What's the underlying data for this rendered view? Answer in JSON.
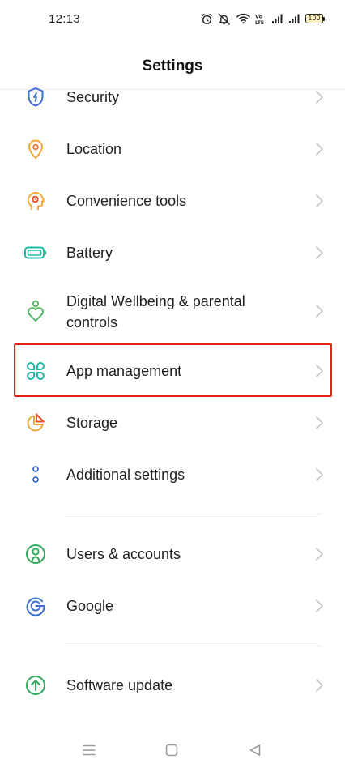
{
  "status_bar": {
    "time": "12:13",
    "battery_level": "100",
    "icons": [
      "alarm-icon",
      "mute-icon",
      "wifi-icon",
      "volte-icon",
      "signal-1-icon",
      "signal-2-icon",
      "battery-icon"
    ]
  },
  "header": {
    "title": "Settings"
  },
  "menu": {
    "items": [
      {
        "label": "Security",
        "icon": "shield-icon",
        "color": "#3d6fd1"
      },
      {
        "label": "Location",
        "icon": "location-pin-icon",
        "color": "#f0a83a"
      },
      {
        "label": "Convenience tools",
        "icon": "head-gear-icon",
        "color": "#f0883a"
      },
      {
        "label": "Battery",
        "icon": "battery-icon",
        "color": "#1fb8a6"
      },
      {
        "label": "Digital Wellbeing & parental controls",
        "label_line1": "Digital Wellbeing & parental",
        "label_line2": "controls",
        "icon": "wellbeing-heart-icon",
        "color": "#5cb96a"
      },
      {
        "label": "App management",
        "icon": "app-grid-icon",
        "color": "#1fb8a6",
        "highlighted": true
      },
      {
        "label": "Storage",
        "icon": "pie-chart-icon",
        "color": "#f0a83a"
      },
      {
        "label": "Additional settings",
        "icon": "dots-icon",
        "color": "#3d6fd1"
      },
      {
        "label": "Users & accounts",
        "icon": "user-icon",
        "color": "#2faa5a"
      },
      {
        "label": "Google",
        "icon": "google-icon",
        "color": "#3d6fd1"
      },
      {
        "label": "Software update",
        "icon": "update-arrow-icon",
        "color": "#2faa5a"
      }
    ]
  },
  "highlight_color": "#e2231a",
  "nav_bar": {
    "buttons": [
      "menu-icon",
      "home-icon",
      "back-icon"
    ]
  }
}
